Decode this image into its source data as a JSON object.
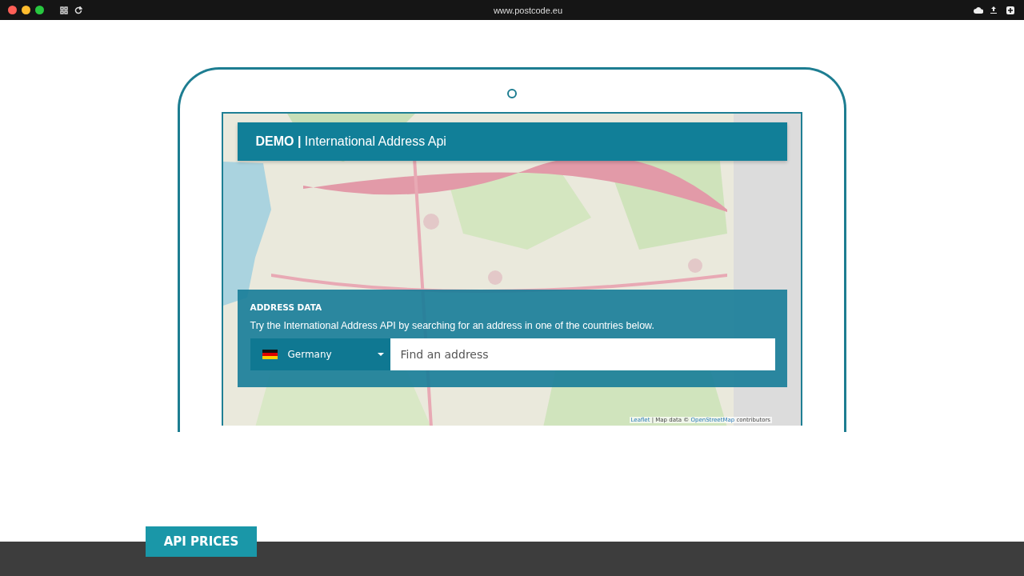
{
  "browser": {
    "url": "www.postcode.eu"
  },
  "demo": {
    "title": "**DEMO |** International Address Api",
    "section_label": "ADDRESS DATA",
    "description": "Try the International Address API by searching for an address in one of the countries below.",
    "country_select": {
      "value": "Germany"
    },
    "address_field": {
      "placeholder": "Find an address"
    },
    "map": {
      "kind": "picture",
      "attribution": [
        {
          "kind": "link",
          "text": "Leaflet"
        },
        {
          "kind": "text",
          "text": "| Map data ©"
        },
        {
          "kind": "link",
          "text": "OpenStreetMap"
        },
        {
          "kind": "text",
          "text": "contributors"
        }
      ]
    }
  },
  "footer": {
    "button": "API PRICES"
  }
}
